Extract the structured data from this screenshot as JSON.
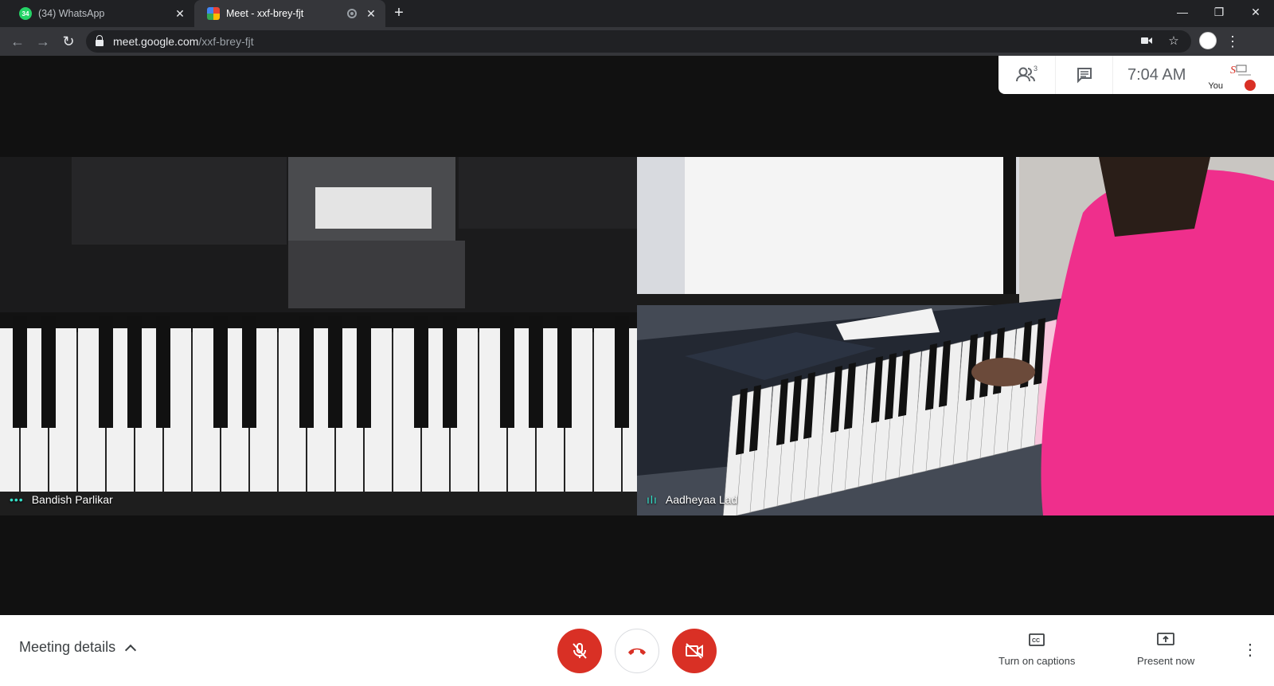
{
  "browser": {
    "tabs": [
      {
        "label": "(34) WhatsApp",
        "badge": "34",
        "favicon_color": "#25d366",
        "active": false
      },
      {
        "label": "Meet - xxf-brey-fjt",
        "active": true
      }
    ],
    "url_host": "meet.google.com",
    "url_path": "/xxf-brey-fjt"
  },
  "meet": {
    "participant_count": "3",
    "clock": "7:04 AM",
    "self_label": "You",
    "participants": [
      {
        "name": "Bandish Parlikar"
      },
      {
        "name": "Aadheyaa Lad"
      }
    ],
    "bottom": {
      "meeting_details": "Meeting details",
      "captions": "Turn on captions",
      "present": "Present now"
    }
  }
}
